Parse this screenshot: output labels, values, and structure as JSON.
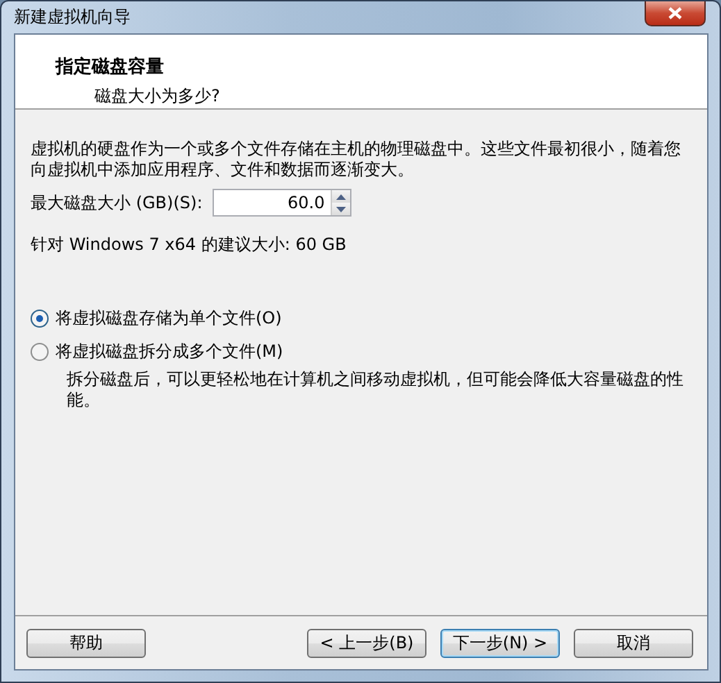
{
  "window": {
    "title": "新建虚拟机向导"
  },
  "header": {
    "title": "指定磁盘容量",
    "subtitle": "磁盘大小为多少?"
  },
  "description": "虚拟机的硬盘作为一个或多个文件存储在主机的物理磁盘中。这些文件最初很小，随着您向虚拟机中添加应用程序、文件和数据而逐渐变大。",
  "disk_size": {
    "label": "最大磁盘大小 (GB)(S):",
    "value": "60.0"
  },
  "recommendation": "针对 Windows 7 x64 的建议大小: 60 GB",
  "options": [
    {
      "label": "将虚拟磁盘存储为单个文件(O)",
      "selected": true
    },
    {
      "label": "将虚拟磁盘拆分成多个文件(M)",
      "selected": false,
      "note": "拆分磁盘后，可以更轻松地在计算机之间移动虚拟机，但可能会降低大容量磁盘的性能。"
    }
  ],
  "buttons": [
    {
      "label": "帮助",
      "kind": "help",
      "default": false
    },
    {
      "label": "< 上一步(B)",
      "kind": "back",
      "default": false
    },
    {
      "label": "下一步(N) >",
      "kind": "next",
      "default": true
    },
    {
      "label": "取消",
      "kind": "cancel",
      "default": false
    }
  ]
}
